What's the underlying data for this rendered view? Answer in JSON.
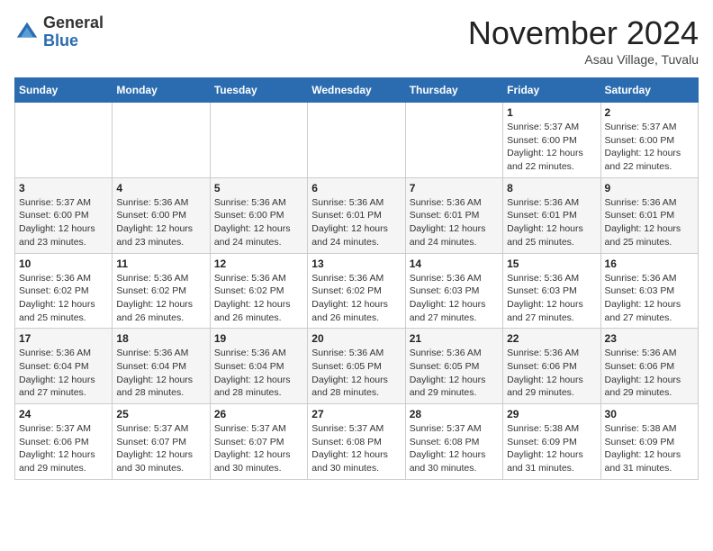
{
  "header": {
    "logo_line1": "General",
    "logo_line2": "Blue",
    "month": "November 2024",
    "location": "Asau Village, Tuvalu"
  },
  "days_of_week": [
    "Sunday",
    "Monday",
    "Tuesday",
    "Wednesday",
    "Thursday",
    "Friday",
    "Saturday"
  ],
  "weeks": [
    [
      {
        "day": "",
        "info": ""
      },
      {
        "day": "",
        "info": ""
      },
      {
        "day": "",
        "info": ""
      },
      {
        "day": "",
        "info": ""
      },
      {
        "day": "",
        "info": ""
      },
      {
        "day": "1",
        "info": "Sunrise: 5:37 AM\nSunset: 6:00 PM\nDaylight: 12 hours\nand 22 minutes."
      },
      {
        "day": "2",
        "info": "Sunrise: 5:37 AM\nSunset: 6:00 PM\nDaylight: 12 hours\nand 22 minutes."
      }
    ],
    [
      {
        "day": "3",
        "info": "Sunrise: 5:37 AM\nSunset: 6:00 PM\nDaylight: 12 hours\nand 23 minutes."
      },
      {
        "day": "4",
        "info": "Sunrise: 5:36 AM\nSunset: 6:00 PM\nDaylight: 12 hours\nand 23 minutes."
      },
      {
        "day": "5",
        "info": "Sunrise: 5:36 AM\nSunset: 6:00 PM\nDaylight: 12 hours\nand 24 minutes."
      },
      {
        "day": "6",
        "info": "Sunrise: 5:36 AM\nSunset: 6:01 PM\nDaylight: 12 hours\nand 24 minutes."
      },
      {
        "day": "7",
        "info": "Sunrise: 5:36 AM\nSunset: 6:01 PM\nDaylight: 12 hours\nand 24 minutes."
      },
      {
        "day": "8",
        "info": "Sunrise: 5:36 AM\nSunset: 6:01 PM\nDaylight: 12 hours\nand 25 minutes."
      },
      {
        "day": "9",
        "info": "Sunrise: 5:36 AM\nSunset: 6:01 PM\nDaylight: 12 hours\nand 25 minutes."
      }
    ],
    [
      {
        "day": "10",
        "info": "Sunrise: 5:36 AM\nSunset: 6:02 PM\nDaylight: 12 hours\nand 25 minutes."
      },
      {
        "day": "11",
        "info": "Sunrise: 5:36 AM\nSunset: 6:02 PM\nDaylight: 12 hours\nand 26 minutes."
      },
      {
        "day": "12",
        "info": "Sunrise: 5:36 AM\nSunset: 6:02 PM\nDaylight: 12 hours\nand 26 minutes."
      },
      {
        "day": "13",
        "info": "Sunrise: 5:36 AM\nSunset: 6:02 PM\nDaylight: 12 hours\nand 26 minutes."
      },
      {
        "day": "14",
        "info": "Sunrise: 5:36 AM\nSunset: 6:03 PM\nDaylight: 12 hours\nand 27 minutes."
      },
      {
        "day": "15",
        "info": "Sunrise: 5:36 AM\nSunset: 6:03 PM\nDaylight: 12 hours\nand 27 minutes."
      },
      {
        "day": "16",
        "info": "Sunrise: 5:36 AM\nSunset: 6:03 PM\nDaylight: 12 hours\nand 27 minutes."
      }
    ],
    [
      {
        "day": "17",
        "info": "Sunrise: 5:36 AM\nSunset: 6:04 PM\nDaylight: 12 hours\nand 27 minutes."
      },
      {
        "day": "18",
        "info": "Sunrise: 5:36 AM\nSunset: 6:04 PM\nDaylight: 12 hours\nand 28 minutes."
      },
      {
        "day": "19",
        "info": "Sunrise: 5:36 AM\nSunset: 6:04 PM\nDaylight: 12 hours\nand 28 minutes."
      },
      {
        "day": "20",
        "info": "Sunrise: 5:36 AM\nSunset: 6:05 PM\nDaylight: 12 hours\nand 28 minutes."
      },
      {
        "day": "21",
        "info": "Sunrise: 5:36 AM\nSunset: 6:05 PM\nDaylight: 12 hours\nand 29 minutes."
      },
      {
        "day": "22",
        "info": "Sunrise: 5:36 AM\nSunset: 6:06 PM\nDaylight: 12 hours\nand 29 minutes."
      },
      {
        "day": "23",
        "info": "Sunrise: 5:36 AM\nSunset: 6:06 PM\nDaylight: 12 hours\nand 29 minutes."
      }
    ],
    [
      {
        "day": "24",
        "info": "Sunrise: 5:37 AM\nSunset: 6:06 PM\nDaylight: 12 hours\nand 29 minutes."
      },
      {
        "day": "25",
        "info": "Sunrise: 5:37 AM\nSunset: 6:07 PM\nDaylight: 12 hours\nand 30 minutes."
      },
      {
        "day": "26",
        "info": "Sunrise: 5:37 AM\nSunset: 6:07 PM\nDaylight: 12 hours\nand 30 minutes."
      },
      {
        "day": "27",
        "info": "Sunrise: 5:37 AM\nSunset: 6:08 PM\nDaylight: 12 hours\nand 30 minutes."
      },
      {
        "day": "28",
        "info": "Sunrise: 5:37 AM\nSunset: 6:08 PM\nDaylight: 12 hours\nand 30 minutes."
      },
      {
        "day": "29",
        "info": "Sunrise: 5:38 AM\nSunset: 6:09 PM\nDaylight: 12 hours\nand 31 minutes."
      },
      {
        "day": "30",
        "info": "Sunrise: 5:38 AM\nSunset: 6:09 PM\nDaylight: 12 hours\nand 31 minutes."
      }
    ]
  ]
}
